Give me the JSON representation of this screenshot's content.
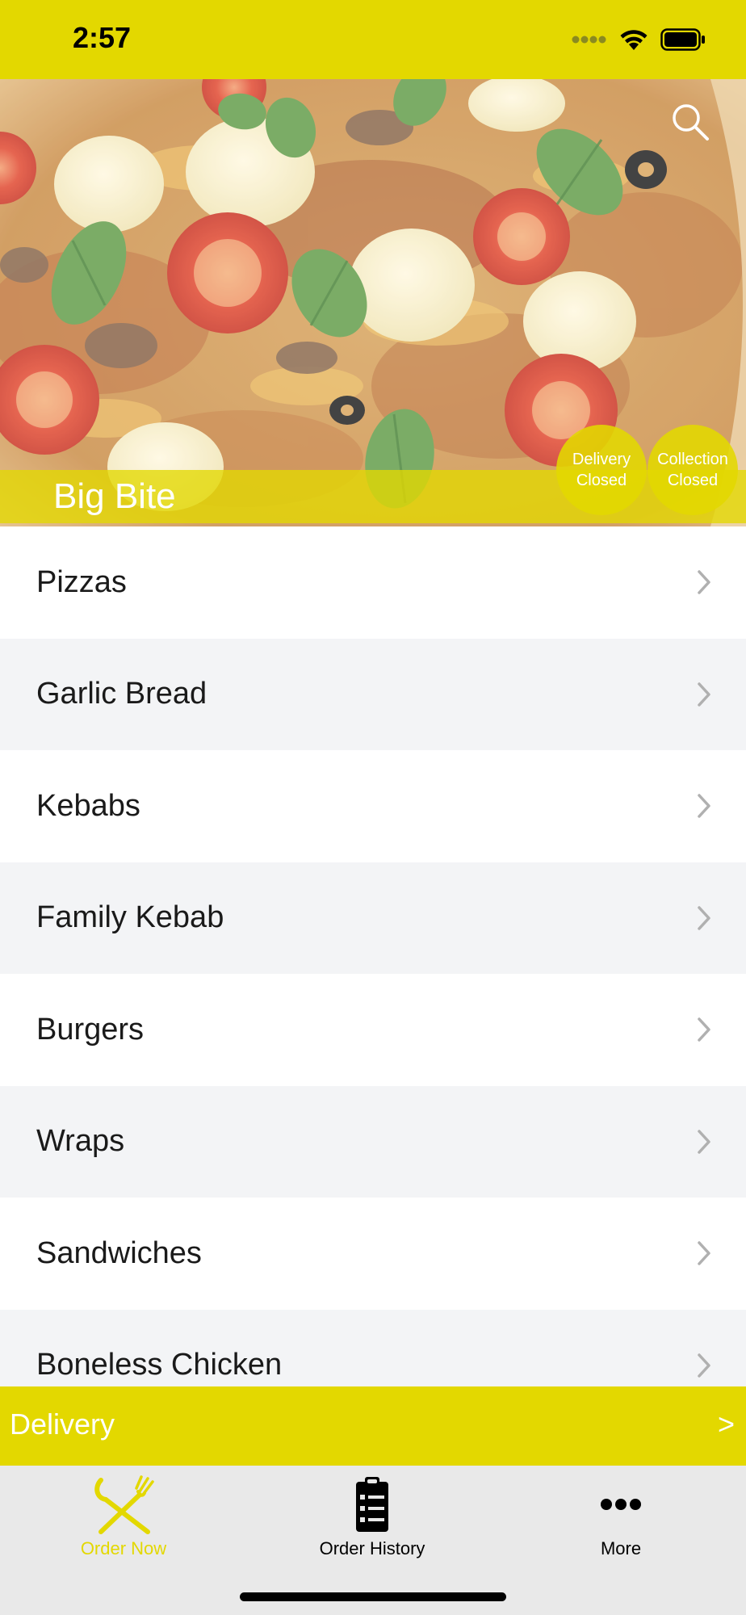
{
  "status_bar": {
    "time": "2:57",
    "icons": [
      "signal-icon",
      "wifi-icon",
      "battery-icon"
    ]
  },
  "hero": {
    "restaurant_name": "Big Bite",
    "image": "pizza-photo",
    "badges": [
      {
        "line1": "Delivery",
        "line2": "Closed"
      },
      {
        "line1": "Collection",
        "line2": "Closed"
      }
    ]
  },
  "menu": {
    "categories": [
      "Pizzas",
      "Garlic Bread",
      "Kebabs",
      "Family Kebab",
      "Burgers",
      "Wraps",
      "Sandwiches",
      "Boneless Chicken"
    ]
  },
  "delivery_bar": {
    "label": "Delivery",
    "arrow": ">"
  },
  "tab_bar": {
    "tabs": [
      {
        "label": "Order Now",
        "icon": "fork-knife-icon",
        "active": true
      },
      {
        "label": "Order History",
        "icon": "clipboard-icon",
        "active": false
      },
      {
        "label": "More",
        "icon": "more-dots-icon",
        "active": false
      }
    ]
  },
  "colors": {
    "accent": "#e3d800",
    "row_alt": "#f3f4f6",
    "tab_bar_bg": "#e9e9e9"
  }
}
